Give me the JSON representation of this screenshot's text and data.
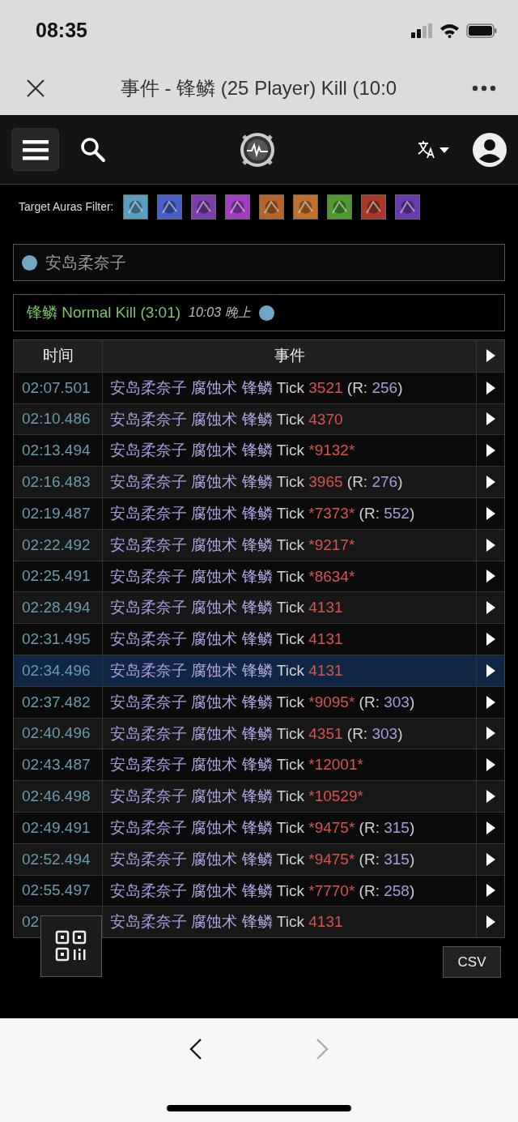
{
  "status_bar": {
    "time": "08:35"
  },
  "nav_bar": {
    "title": "事件 - 锋鳞 (25 Player) Kill (10:0"
  },
  "aura_filter": {
    "label": "Target Auras Filter:",
    "auras": [
      {
        "color": "#5a9ec4"
      },
      {
        "color": "#4b5fc8"
      },
      {
        "color": "#7a3fa8"
      },
      {
        "color": "#a040c0"
      },
      {
        "color": "#b5652a"
      },
      {
        "color": "#c0702a"
      },
      {
        "color": "#4e9a2e"
      },
      {
        "color": "#a83a2a"
      },
      {
        "color": "#6a3ab0"
      }
    ]
  },
  "player": {
    "name": "安岛柔奈子",
    "color": "#6fa8c0"
  },
  "fight": {
    "title": "锋鳞 Normal Kill (3:01)",
    "time": "10:03 晚上",
    "color": "#6fa8c0"
  },
  "table": {
    "columns": [
      "时间",
      "事件"
    ],
    "rows": [
      {
        "time": "02:07.501",
        "selected": false,
        "parts": [
          {
            "kind": "source",
            "text": "安岛柔奈子"
          },
          {
            "kind": "ability",
            "text": "腐蚀术"
          },
          {
            "kind": "target",
            "text": "锋鳞"
          },
          {
            "kind": "plain",
            "text": "Tick"
          },
          {
            "kind": "amount",
            "text": "3521"
          },
          {
            "kind": "plain",
            "text": "(R:"
          },
          {
            "kind": "resist",
            "text": "256"
          },
          {
            "kind": "close",
            "text": ")"
          }
        ]
      },
      {
        "time": "02:10.486",
        "selected": false,
        "parts": [
          {
            "kind": "source",
            "text": "安岛柔奈子"
          },
          {
            "kind": "ability",
            "text": "腐蚀术"
          },
          {
            "kind": "target",
            "text": "锋鳞"
          },
          {
            "kind": "plain",
            "text": "Tick"
          },
          {
            "kind": "amount",
            "text": "4370"
          }
        ]
      },
      {
        "time": "02:13.494",
        "selected": false,
        "parts": [
          {
            "kind": "source",
            "text": "安岛柔奈子"
          },
          {
            "kind": "ability",
            "text": "腐蚀术"
          },
          {
            "kind": "target",
            "text": "锋鳞"
          },
          {
            "kind": "plain",
            "text": "Tick"
          },
          {
            "kind": "amount",
            "text": "*9132*"
          }
        ]
      },
      {
        "time": "02:16.483",
        "selected": false,
        "parts": [
          {
            "kind": "source",
            "text": "安岛柔奈子"
          },
          {
            "kind": "ability",
            "text": "腐蚀术"
          },
          {
            "kind": "target",
            "text": "锋鳞"
          },
          {
            "kind": "plain",
            "text": "Tick"
          },
          {
            "kind": "amount",
            "text": "3965"
          },
          {
            "kind": "plain",
            "text": "(R:"
          },
          {
            "kind": "resist",
            "text": "276"
          },
          {
            "kind": "close",
            "text": ")"
          }
        ]
      },
      {
        "time": "02:19.487",
        "selected": false,
        "parts": [
          {
            "kind": "source",
            "text": "安岛柔奈子"
          },
          {
            "kind": "ability",
            "text": "腐蚀术"
          },
          {
            "kind": "target",
            "text": "锋鳞"
          },
          {
            "kind": "plain",
            "text": "Tick"
          },
          {
            "kind": "amount",
            "text": "*7373*"
          },
          {
            "kind": "plain",
            "text": "(R:"
          },
          {
            "kind": "resist",
            "text": "552"
          },
          {
            "kind": "close",
            "text": ")"
          }
        ]
      },
      {
        "time": "02:22.492",
        "selected": false,
        "parts": [
          {
            "kind": "source",
            "text": "安岛柔奈子"
          },
          {
            "kind": "ability",
            "text": "腐蚀术"
          },
          {
            "kind": "target",
            "text": "锋鳞"
          },
          {
            "kind": "plain",
            "text": "Tick"
          },
          {
            "kind": "amount",
            "text": "*9217*"
          }
        ]
      },
      {
        "time": "02:25.491",
        "selected": false,
        "parts": [
          {
            "kind": "source",
            "text": "安岛柔奈子"
          },
          {
            "kind": "ability",
            "text": "腐蚀术"
          },
          {
            "kind": "target",
            "text": "锋鳞"
          },
          {
            "kind": "plain",
            "text": "Tick"
          },
          {
            "kind": "amount",
            "text": "*8634*"
          }
        ]
      },
      {
        "time": "02:28.494",
        "selected": false,
        "parts": [
          {
            "kind": "source",
            "text": "安岛柔奈子"
          },
          {
            "kind": "ability",
            "text": "腐蚀术"
          },
          {
            "kind": "target",
            "text": "锋鳞"
          },
          {
            "kind": "plain",
            "text": "Tick"
          },
          {
            "kind": "amount",
            "text": "4131"
          }
        ]
      },
      {
        "time": "02:31.495",
        "selected": false,
        "parts": [
          {
            "kind": "source",
            "text": "安岛柔奈子"
          },
          {
            "kind": "ability",
            "text": "腐蚀术"
          },
          {
            "kind": "target",
            "text": "锋鳞"
          },
          {
            "kind": "plain",
            "text": "Tick"
          },
          {
            "kind": "amount",
            "text": "4131"
          }
        ]
      },
      {
        "time": "02:34.496",
        "selected": true,
        "parts": [
          {
            "kind": "source",
            "text": "安岛柔奈子"
          },
          {
            "kind": "ability",
            "text": "腐蚀术"
          },
          {
            "kind": "target",
            "text": "锋鳞"
          },
          {
            "kind": "plain",
            "text": "Tick"
          },
          {
            "kind": "amount",
            "text": "4131"
          }
        ]
      },
      {
        "time": "02:37.482",
        "selected": false,
        "parts": [
          {
            "kind": "source",
            "text": "安岛柔奈子"
          },
          {
            "kind": "ability",
            "text": "腐蚀术"
          },
          {
            "kind": "target",
            "text": "锋鳞"
          },
          {
            "kind": "plain",
            "text": "Tick"
          },
          {
            "kind": "amount",
            "text": "*9095*"
          },
          {
            "kind": "plain",
            "text": "(R:"
          },
          {
            "kind": "resist",
            "text": "303"
          },
          {
            "kind": "close",
            "text": ")"
          }
        ]
      },
      {
        "time": "02:40.496",
        "selected": false,
        "parts": [
          {
            "kind": "source",
            "text": "安岛柔奈子"
          },
          {
            "kind": "ability",
            "text": "腐蚀术"
          },
          {
            "kind": "target",
            "text": "锋鳞"
          },
          {
            "kind": "plain",
            "text": "Tick"
          },
          {
            "kind": "amount",
            "text": "4351"
          },
          {
            "kind": "plain",
            "text": "(R:"
          },
          {
            "kind": "resist",
            "text": "303"
          },
          {
            "kind": "close",
            "text": ")"
          }
        ]
      },
      {
        "time": "02:43.487",
        "selected": false,
        "parts": [
          {
            "kind": "source",
            "text": "安岛柔奈子"
          },
          {
            "kind": "ability",
            "text": "腐蚀术"
          },
          {
            "kind": "target",
            "text": "锋鳞"
          },
          {
            "kind": "plain",
            "text": "Tick"
          },
          {
            "kind": "amount",
            "text": "*12001*"
          }
        ]
      },
      {
        "time": "02:46.498",
        "selected": false,
        "parts": [
          {
            "kind": "source",
            "text": "安岛柔奈子"
          },
          {
            "kind": "ability",
            "text": "腐蚀术"
          },
          {
            "kind": "target",
            "text": "锋鳞"
          },
          {
            "kind": "plain",
            "text": "Tick"
          },
          {
            "kind": "amount",
            "text": "*10529*"
          }
        ]
      },
      {
        "time": "02:49.491",
        "selected": false,
        "parts": [
          {
            "kind": "source",
            "text": "安岛柔奈子"
          },
          {
            "kind": "ability",
            "text": "腐蚀术"
          },
          {
            "kind": "target",
            "text": "锋鳞"
          },
          {
            "kind": "plain",
            "text": "Tick"
          },
          {
            "kind": "amount",
            "text": "*9475*"
          },
          {
            "kind": "plain",
            "text": "(R:"
          },
          {
            "kind": "resist",
            "text": "315"
          },
          {
            "kind": "close",
            "text": ")"
          }
        ]
      },
      {
        "time": "02:52.494",
        "selected": false,
        "parts": [
          {
            "kind": "source",
            "text": "安岛柔奈子"
          },
          {
            "kind": "ability",
            "text": "腐蚀术"
          },
          {
            "kind": "target",
            "text": "锋鳞"
          },
          {
            "kind": "plain",
            "text": "Tick"
          },
          {
            "kind": "amount",
            "text": "*9475*"
          },
          {
            "kind": "plain",
            "text": "(R:"
          },
          {
            "kind": "resist",
            "text": "315"
          },
          {
            "kind": "close",
            "text": ")"
          }
        ]
      },
      {
        "time": "02:55.497",
        "selected": false,
        "parts": [
          {
            "kind": "source",
            "text": "安岛柔奈子"
          },
          {
            "kind": "ability",
            "text": "腐蚀术"
          },
          {
            "kind": "target",
            "text": "锋鳞"
          },
          {
            "kind": "plain",
            "text": "Tick"
          },
          {
            "kind": "amount",
            "text": "*7770*"
          },
          {
            "kind": "plain",
            "text": "(R:"
          },
          {
            "kind": "resist",
            "text": "258"
          },
          {
            "kind": "close",
            "text": ")"
          }
        ]
      },
      {
        "time": "02",
        "selected": false,
        "parts": [
          {
            "kind": "source",
            "text": "安岛柔奈子"
          },
          {
            "kind": "ability",
            "text": "腐蚀术"
          },
          {
            "kind": "target",
            "text": "锋鳞"
          },
          {
            "kind": "plain",
            "text": "Tick"
          },
          {
            "kind": "amount",
            "text": "4131"
          }
        ]
      }
    ]
  },
  "csv_button": "CSV"
}
